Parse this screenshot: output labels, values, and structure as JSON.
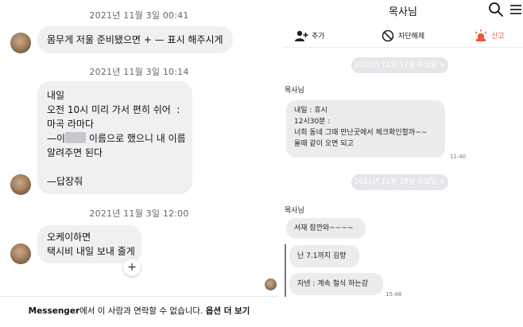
{
  "messenger": {
    "timestamps": [
      "2021년 11월 3일 00:41",
      "2021년 11월 3일 10:14",
      "2021년 11월 3일 12:00"
    ],
    "message1": "몸무게 저울 준비됐으면 + — 표시 해주시게",
    "message2": {
      "lines": [
        "내일",
        "오전 10시 미리 가서 편히 쉬어  :",
        "마곡 라마다",
        "—이",
        "이름으로 했으니 내 이름",
        "알려주면 된다",
        "",
        "—답장줘"
      ]
    },
    "message3": {
      "lines": [
        "오케이하면",
        "택시비 내일 보내 줄게"
      ]
    },
    "reaction": "+",
    "footer": {
      "prefix": "Messenger",
      "middle": "에서 이 사람과 연락할 수 없습니다. ",
      "link": "옵션 더 보기"
    }
  },
  "kakao": {
    "title": "목사님",
    "actions": {
      "add": "추가",
      "block": "차단해제",
      "report": "신고"
    },
    "date1": "2021년 11월 17일 수요일 >",
    "date2": "2021년 11월 18일 수요일 >",
    "sender": "목사님",
    "message1": {
      "lines": [
        "내일 : 휴시",
        "12시30분 :",
        "너희 동네 그때 만난곳에서 체크확인할까~~",
        "올때 같이 오면 되고"
      ]
    },
    "time1": "11:40",
    "message2": "서재 잠깐와~~~~",
    "message3": "난 7.1까지 김량",
    "message4": "자넨 : 계속 철식 하는감",
    "time2": "15:48",
    "colors": {
      "report": "#f2553a",
      "bubble": "#ececee"
    }
  }
}
